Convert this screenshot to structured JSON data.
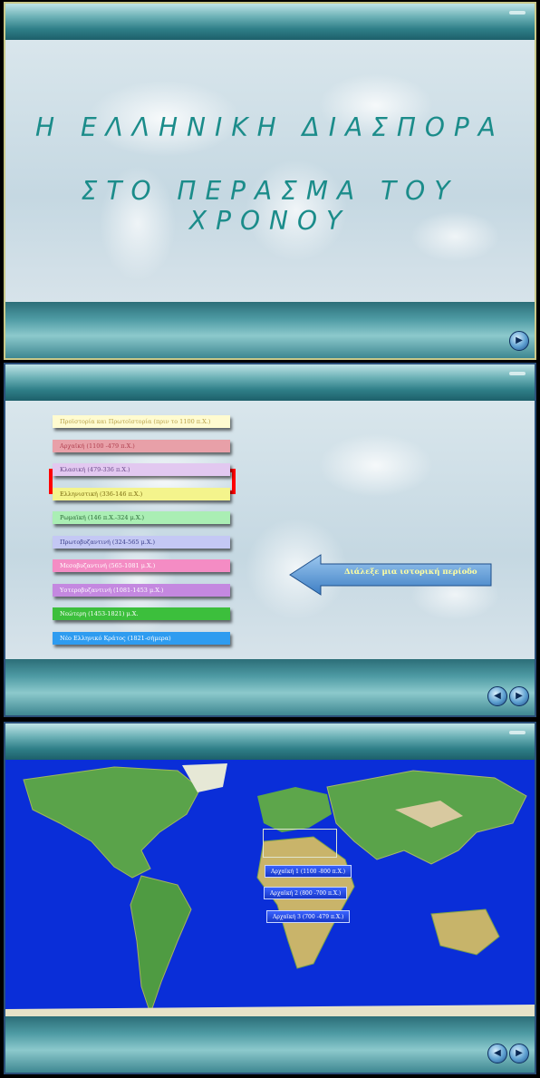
{
  "slide1": {
    "title_line1": "Η ΕΛΛΗΝΙΚΗ ΔΙΑΣΠΟΡΑ",
    "title_line2": "ΣΤΟ ΠΕΡΑΣΜΑ ΤΟΥ ΧΡΟΝΟΥ",
    "next_icon": "next-circle-icon"
  },
  "slide2": {
    "periods": [
      {
        "label": "Προϊστορία και Πρωτοϊστορία (πριν το 1100 π.Χ.)",
        "color": "#fffbd0",
        "text": "#b8a24a"
      },
      {
        "label": "Αρχαϊκή (1100 -479 π.Χ.)",
        "color": "#e8a0a8",
        "text": "#b04050"
      },
      {
        "label": "Κλασική (479-336 π.Χ.)",
        "color": "#e2c8f0",
        "text": "#6a4a8a"
      },
      {
        "label": "Ελληνιστική (336-146 π.Χ.)",
        "color": "#f4f48c",
        "text": "#7a6a10"
      },
      {
        "label": "Ρωμαϊκή (146 π.Χ.-324 μ.Χ.)",
        "color": "#aaeeb4",
        "text": "#2a6a36"
      },
      {
        "label": "Πρωτοβυζαντινή (324-565 μ.Χ.)",
        "color": "#c4c8f4",
        "text": "#3a3e8a"
      },
      {
        "label": "Μεσοβυζαντινή (565-1081 μ.Χ.)",
        "color": "#f48cc4",
        "text": "#ffffff"
      },
      {
        "label": "Υστεροβυζαντινή (1081-1453 μ.Χ.)",
        "color": "#c488e0",
        "text": "#ffffff"
      },
      {
        "label": "Νεώτερη (1453-1821) μ.Χ.",
        "color": "#3cbf3c",
        "text": "#ffffff"
      },
      {
        "label": "Νέο Ελληνικό Κράτος (1821-σήμερα)",
        "color": "#2e9cf0",
        "text": "#ffffff"
      }
    ],
    "selected_index": 1,
    "prompt": "Διάλεξε μια ιστορική περίοδο",
    "nav_icons": [
      "previous-circle-icon",
      "next-circle-icon"
    ]
  },
  "slide3": {
    "map_buttons": [
      {
        "label": "Αρχαϊκή 1 (1100 -800 π.Χ.)"
      },
      {
        "label": "Αρχαϊκή 2 (800 -700 π.Χ.)"
      },
      {
        "label": "Αρχαϊκή 3 (700 -479 π.Χ.)"
      }
    ],
    "nav_icons": [
      "previous-circle-icon",
      "next-circle-icon"
    ]
  }
}
